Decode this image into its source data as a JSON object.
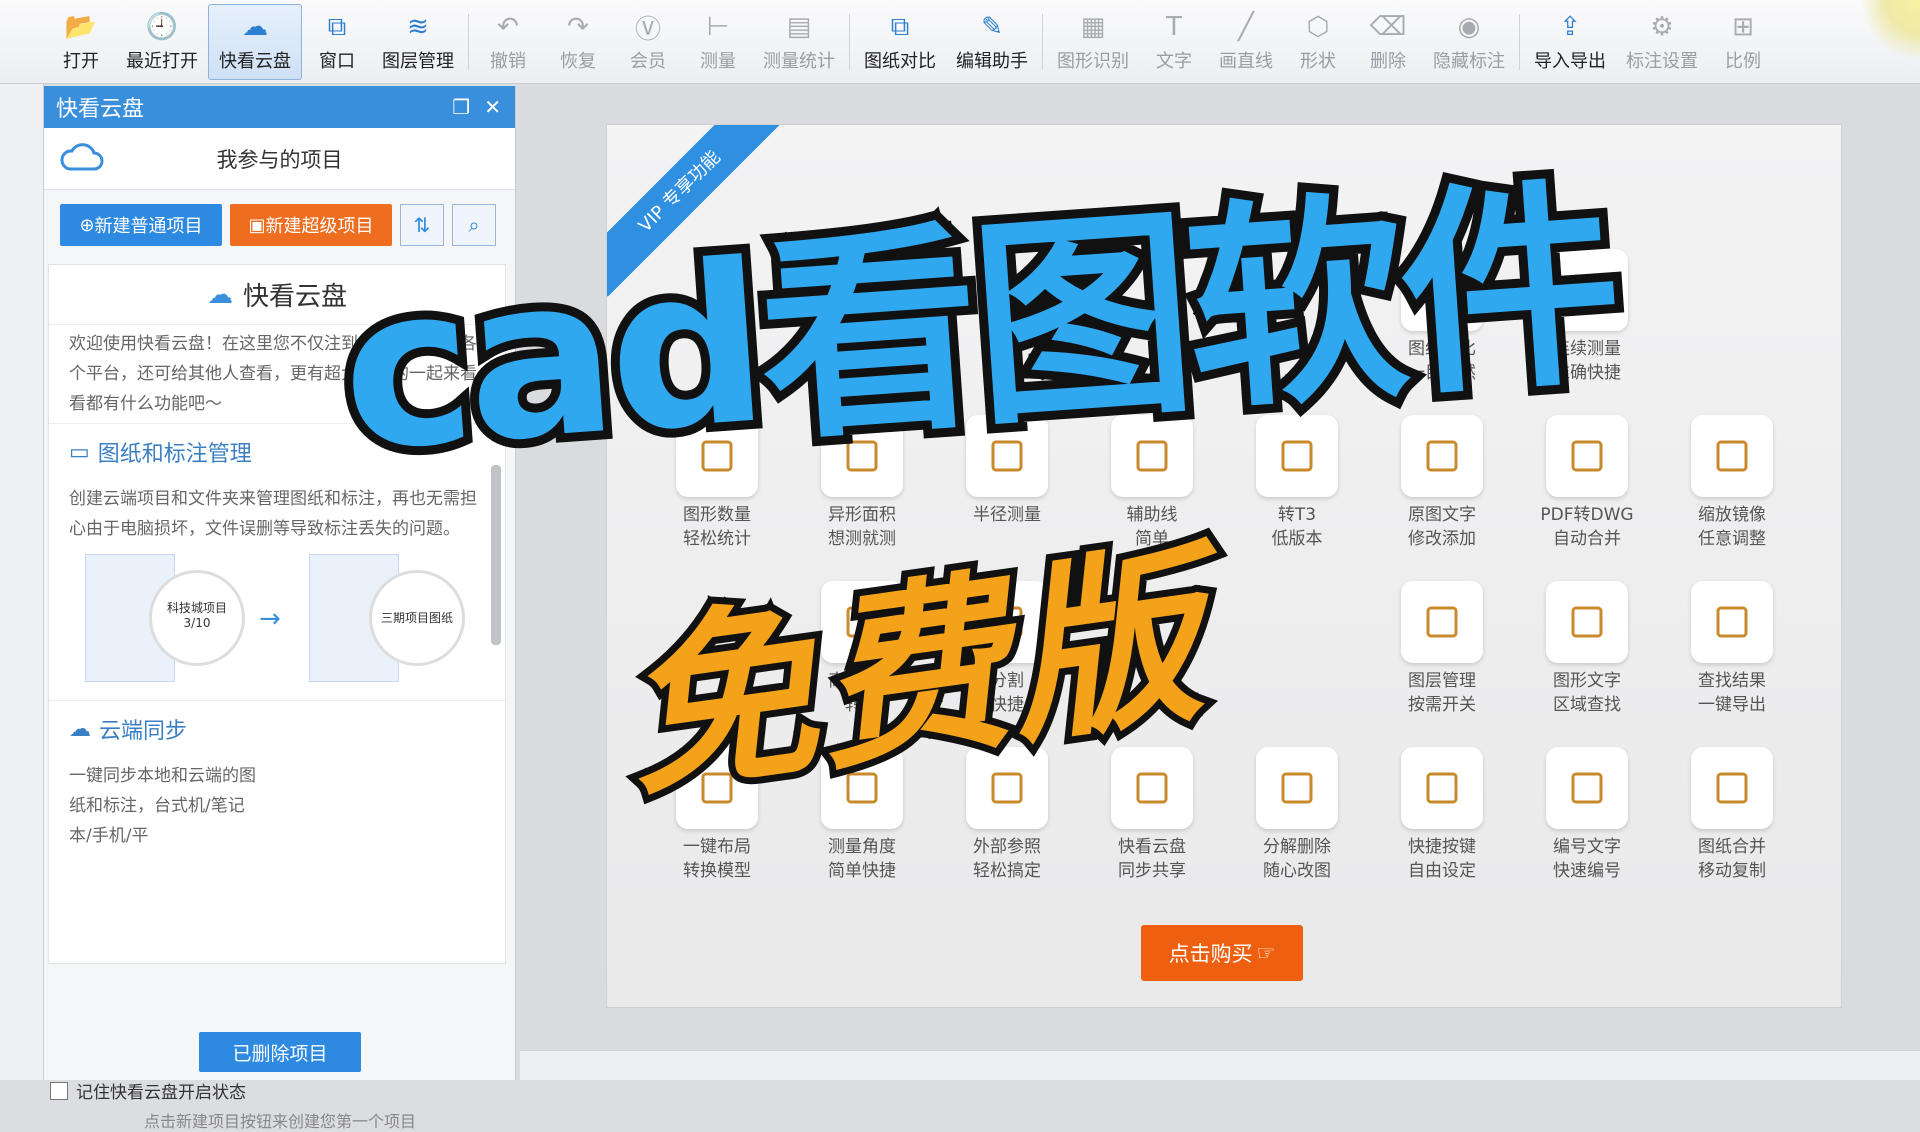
{
  "toolbar": {
    "items": [
      {
        "label": "打开",
        "icon": "folder-open-icon",
        "enabled": true
      },
      {
        "label": "最近打开",
        "icon": "clock-icon",
        "enabled": true
      },
      {
        "label": "快看云盘",
        "icon": "cloud-icon",
        "enabled": true,
        "active": true
      },
      {
        "label": "窗口",
        "icon": "window-icon",
        "enabled": true
      },
      {
        "label": "图层管理",
        "icon": "layers-icon",
        "enabled": true
      },
      {
        "label": "撤销",
        "icon": "undo-icon",
        "enabled": false
      },
      {
        "label": "恢复",
        "icon": "redo-icon",
        "enabled": false
      },
      {
        "label": "会员",
        "icon": "vip-icon",
        "enabled": false
      },
      {
        "label": "测量",
        "icon": "ruler-icon",
        "enabled": false
      },
      {
        "label": "测量统计",
        "icon": "measure-stats-icon",
        "enabled": false
      },
      {
        "label": "图纸对比",
        "icon": "compare-icon",
        "enabled": true
      },
      {
        "label": "编辑助手",
        "icon": "edit-assistant-icon",
        "enabled": true
      },
      {
        "label": "图形识别",
        "icon": "shape-recognize-icon",
        "enabled": false
      },
      {
        "label": "文字",
        "icon": "text-icon",
        "enabled": false
      },
      {
        "label": "画直线",
        "icon": "line-icon",
        "enabled": false
      },
      {
        "label": "形状",
        "icon": "shape-icon",
        "enabled": false
      },
      {
        "label": "删除",
        "icon": "eraser-icon",
        "enabled": false
      },
      {
        "label": "隐藏标注",
        "icon": "hide-annotation-icon",
        "enabled": false
      },
      {
        "label": "导入导出",
        "icon": "import-export-icon",
        "enabled": true
      },
      {
        "label": "标注设置",
        "icon": "annotation-settings-icon",
        "enabled": false
      },
      {
        "label": "比例",
        "icon": "scale-icon",
        "enabled": false
      }
    ]
  },
  "panel": {
    "title": "快看云盘",
    "project_label": "我参与的项目",
    "new_normal": "新建普通项目",
    "new_super": "新建超级项目",
    "cloud_header": "快看云盘",
    "intro": "欢迎使用快看云盘！在这里您不仅注到手机、电脑等各个平台，还可给其他人查看，更有超大容量的一起来看看都有什么功能吧～",
    "section1_title": "图纸和标注管理",
    "section1_text": "创建云端项目和文件夹来管理图纸和标注，再也无需担心由于电脑损坏，文件误删等导致标注丢失的问题。",
    "thumb_a": "科技城项目",
    "thumb_a_count": "3/10",
    "thumb_b": "三期项目图纸",
    "section2_title": "云端同步",
    "section2_text": "一键同步本地和云端的图纸和标注，台式机/笔记本/手机/平",
    "deleted_button": "已删除项目",
    "remember_label": "记住快看云盘开启状态",
    "hint": "点击新建项目按钮来创建您第一个项目"
  },
  "vip": {
    "ribbon": "VIP 专享功能",
    "features": [
      [
        "图纸对比",
        "一目了然"
      ],
      [
        "连续测量",
        "准确快捷"
      ],
      [
        "图形数量",
        "轻松统计"
      ],
      [
        "异形面积",
        "想测就测"
      ],
      [
        "半径测量",
        ""
      ],
      [
        "辅助线",
        "简单"
      ],
      [
        "转T3",
        "低版本"
      ],
      [
        "原图文字",
        "修改添加"
      ],
      [
        "PDF转DWG",
        "自动合并"
      ],
      [
        "缩放镜像",
        "任意调整"
      ],
      [
        "高清PDF",
        "转就"
      ],
      [
        "分割",
        "快捷"
      ],
      [
        "图层管理",
        "按需开关"
      ],
      [
        "图形文字",
        "区域查找"
      ],
      [
        "查找结果",
        "一键导出"
      ],
      [
        "一键布局",
        "转换模型"
      ],
      [
        "测量角度",
        "简单快捷"
      ],
      [
        "外部参照",
        "轻松搞定"
      ],
      [
        "快看云盘",
        "同步共享"
      ],
      [
        "分解删除",
        "随心改图"
      ],
      [
        "快捷按键",
        "自由设定"
      ],
      [
        "编号文字",
        "快速编号"
      ],
      [
        "图纸合并",
        "移动复制"
      ]
    ],
    "buy": "点击购买"
  },
  "overlay": {
    "title": "cad看图软件",
    "subtitle": "免费版"
  }
}
